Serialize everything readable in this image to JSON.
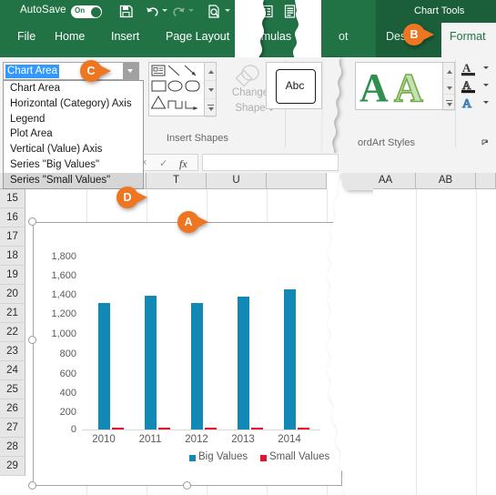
{
  "app": {
    "autosave_label": "AutoSave",
    "autosave_state": "On",
    "quick_access_icons": [
      "save-icon",
      "undo-icon",
      "redo-icon",
      "print-preview-icon",
      "refresh-icon",
      "spreadsheet-icon",
      "form-icon"
    ]
  },
  "ribbon": {
    "tabs": [
      {
        "label": "File"
      },
      {
        "label": "Home"
      },
      {
        "label": "Insert"
      },
      {
        "label": "Page Layout"
      },
      {
        "label": "Formulas"
      },
      {
        "label": "ot"
      },
      {
        "label": "Des"
      }
    ],
    "contextual_title": "Chart Tools",
    "active_tab": "Format",
    "groups": [
      {
        "label": "Insert Shapes"
      },
      {
        "label": "ordArt Styles"
      }
    ],
    "change_shape": {
      "line1": "Change",
      "line2": "Shape"
    },
    "wordart_preview": "Abc"
  },
  "namebox": {
    "value": "Chart Area",
    "options": [
      "Chart Area",
      "Horizontal (Category) Axis",
      "Legend",
      "Plot Area",
      "Vertical (Value) Axis",
      "Series \"Big Values\"",
      "Series \"Small Values\""
    ],
    "selected_option_index": 6
  },
  "formula_bar": {
    "cancel_icon": "×",
    "enter_icon": "✓",
    "function_icon": "fx",
    "value": ""
  },
  "sheet": {
    "column_headers": [
      "T",
      "U",
      "AA",
      "AB"
    ],
    "row_headers": [
      "15",
      "16",
      "17",
      "18",
      "19",
      "20",
      "21",
      "22",
      "23",
      "24",
      "25",
      "26",
      "27",
      "28",
      "29"
    ]
  },
  "callouts": [
    {
      "letter": "A",
      "target": "chart-area"
    },
    {
      "letter": "B",
      "target": "format-tab"
    },
    {
      "letter": "C",
      "target": "name-box"
    },
    {
      "letter": "D",
      "target": "series-small-values-option"
    }
  ],
  "colors": {
    "ribbon_green": "#217346",
    "contextual_green": "#1b5e3a",
    "callout_orange": "#ee7620",
    "big_values": "#1288b4",
    "small_values": "#e8112d",
    "selection_blue": "#3399ff"
  },
  "chart_data": {
    "type": "bar",
    "title": "",
    "xlabel": "",
    "ylabel": "",
    "categories": [
      "2010",
      "2011",
      "2012",
      "2013",
      "2014"
    ],
    "series": [
      {
        "name": "Big Values",
        "color": "#1288b4",
        "values": [
          1250,
          1325,
          1250,
          1315,
          1385
        ]
      },
      {
        "name": "Small Values",
        "color": "#e8112d",
        "values": [
          10,
          12,
          11,
          12,
          13
        ]
      }
    ],
    "ylim": [
      0,
      1800
    ],
    "yticks": [
      "0",
      "200",
      "400",
      "600",
      "800",
      "1,000",
      "1,200",
      "1,400",
      "1,600",
      "1,800"
    ],
    "grid": false,
    "legend_position": "bottom"
  }
}
